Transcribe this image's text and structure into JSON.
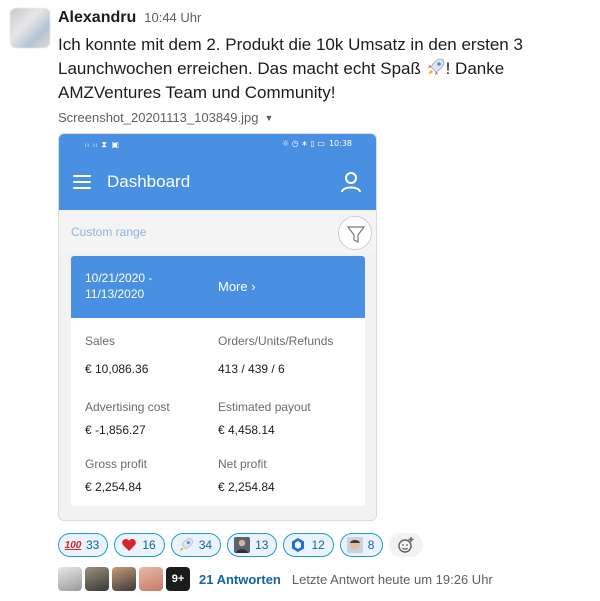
{
  "message": {
    "author": "Alexandru",
    "time": "10:44 Uhr",
    "text_part1": "Ich konnte mit dem 2. Produkt die 10k Umsatz in den ersten 3 Launchwochen erreichen. Das macht echt Spaß ",
    "text_part2": "! Danke AMZVentures Team und Community!",
    "file_name": "Screenshot_20201113_103849.jpg"
  },
  "phone": {
    "status_left": "ₗₗ ₗₗ ⧗ ▣",
    "status_icons": "☼ ◷ ∗ ▯ ▭",
    "status_time": "10:38",
    "app_title": "Dashboard",
    "range_label": "Custom range",
    "date_range": "10/21/2020 - 11/13/2020",
    "more_label": "More ›",
    "metrics": [
      {
        "label": "Sales",
        "value": "€ 10,086.36"
      },
      {
        "label": "Orders/Units/Refunds",
        "value": "413 / 439 / 6"
      },
      {
        "label": "Advertising cost",
        "value": "€ -1,856.27"
      },
      {
        "label": "Estimated payout",
        "value": "€ 4,458.14"
      },
      {
        "label": "Gross profit",
        "value": "€ 2,254.84"
      },
      {
        "label": "Net profit",
        "value": "€ 2,254.84"
      }
    ],
    "colors": {
      "primary": "#4a90e2",
      "range_text": "#8fb3dc"
    }
  },
  "reactions": [
    {
      "emoji": "100-emoji",
      "count": "33"
    },
    {
      "emoji": "heart-emoji",
      "count": "16"
    },
    {
      "emoji": "rocket-emoji",
      "count": "34"
    },
    {
      "emoji": "person-emoji",
      "count": "13"
    },
    {
      "emoji": "hexagon-logo-emoji",
      "count": "12"
    },
    {
      "emoji": "face-emoji",
      "count": "8"
    }
  ],
  "thread": {
    "more_count": "9+",
    "replies": "21 Antworten",
    "last_reply": "Letzte Antwort heute um 19:26 Uhr"
  },
  "colors": {
    "link": "#1264a3",
    "reaction_border": "#1d9bd1",
    "reaction_bg": "#eaf3fc"
  }
}
